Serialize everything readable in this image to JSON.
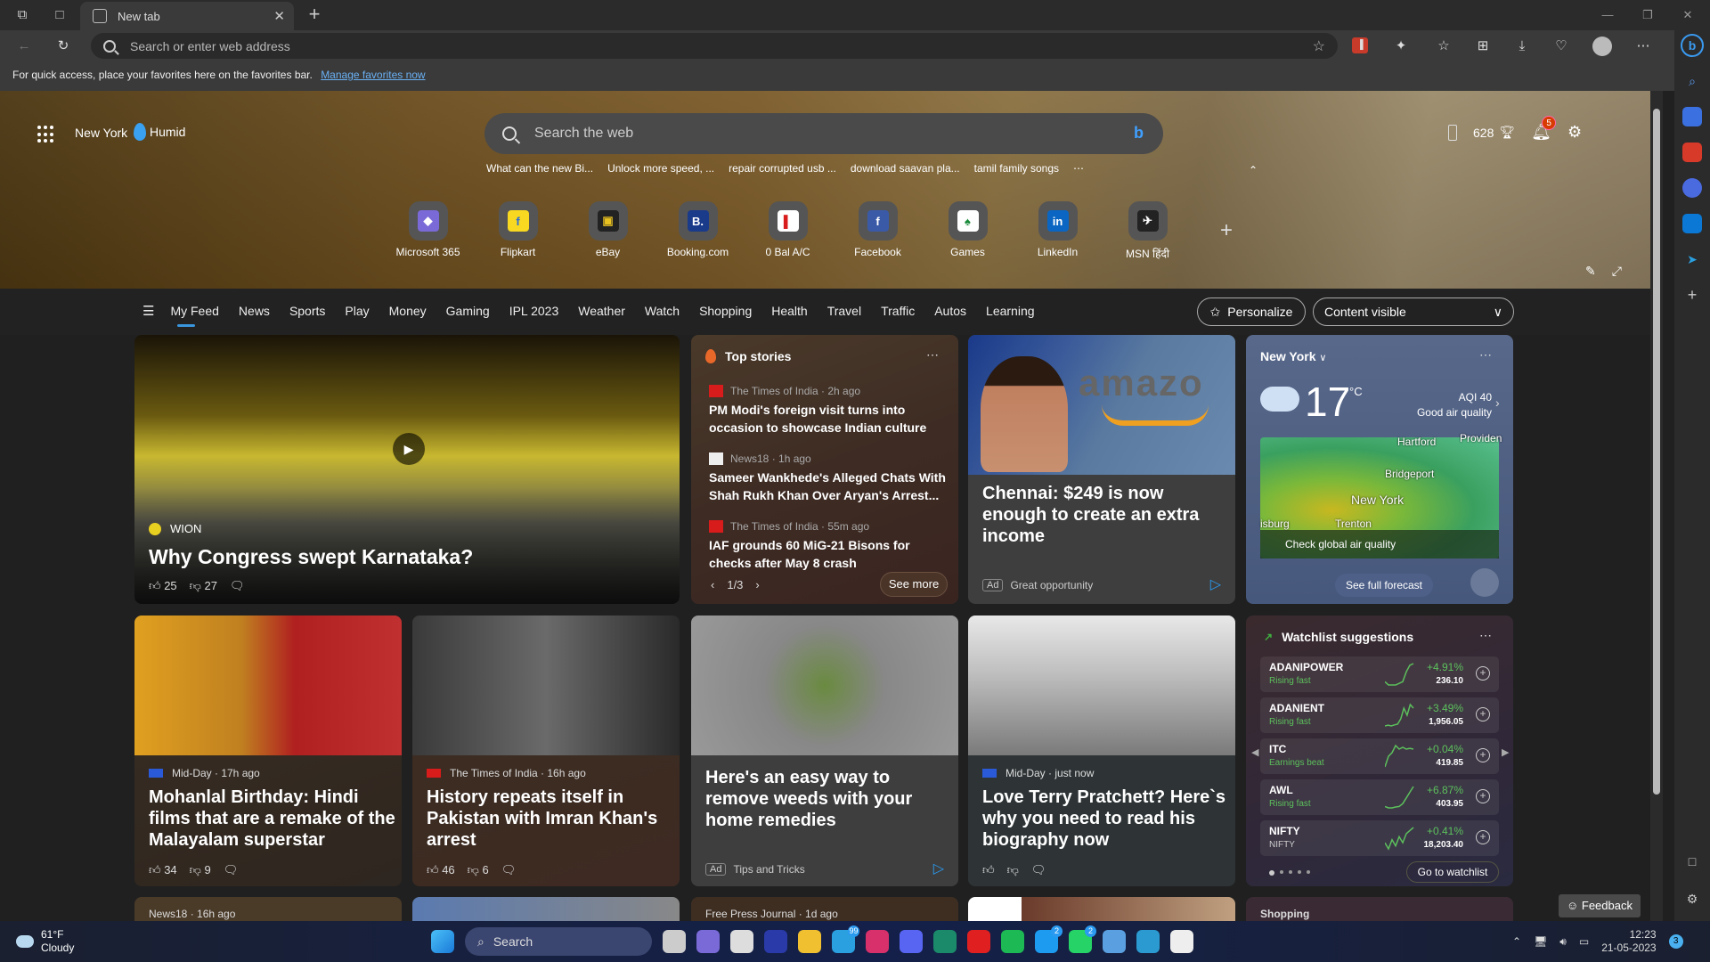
{
  "browser": {
    "tab_title": "New tab",
    "address_placeholder": "Search or enter web address",
    "favorites_bar_message": "For quick access, place your favorites here on the favorites bar.",
    "manage_favorites_link": "Manage favorites now",
    "toolbar_icons": [
      "add-favorite-icon",
      "extension-red-icon",
      "extensions-icon",
      "favorites-icon",
      "collections-icon",
      "downloads-icon",
      "browser-essentials-icon",
      "profile-icon",
      "more-icon",
      "bing-chat-icon"
    ]
  },
  "header": {
    "location": "New York",
    "weather_condition": "Humid",
    "search_placeholder": "Search the web",
    "trending": [
      "What can the new Bi...",
      "Unlock more speed, ...",
      "repair corrupted usb ...",
      "download saavan pla...",
      "tamil family songs"
    ],
    "trending_more": "⋯",
    "rewards_points": "628",
    "notification_count": "5"
  },
  "quick_links": [
    {
      "label": "Microsoft 365",
      "glyph": "◆",
      "bg": "#7a6ad8",
      "fg": "#fff"
    },
    {
      "label": "Flipkart",
      "glyph": "f",
      "bg": "#f8d820",
      "fg": "#2a6ad8"
    },
    {
      "label": "eBay",
      "glyph": "▣",
      "bg": "#222",
      "fg": "#e8c020"
    },
    {
      "label": "Booking.com",
      "glyph": "B.",
      "bg": "#1a3a8a",
      "fg": "#fff"
    },
    {
      "label": "0 Bal A/C",
      "glyph": "▌",
      "bg": "#fff",
      "fg": "#d81b1b"
    },
    {
      "label": "Facebook",
      "glyph": "f",
      "bg": "#3a5aa8",
      "fg": "#fff"
    },
    {
      "label": "Games",
      "glyph": "♠",
      "bg": "#fff",
      "fg": "#1a8a3a"
    },
    {
      "label": "LinkedIn",
      "glyph": "in",
      "bg": "#0a66c2",
      "fg": "#fff"
    },
    {
      "label": "MSN हिंदी",
      "glyph": "✈",
      "bg": "#222",
      "fg": "#fff"
    }
  ],
  "nav": {
    "items": [
      "My Feed",
      "News",
      "Sports",
      "Play",
      "Money",
      "Gaming",
      "IPL 2023",
      "Weather",
      "Watch",
      "Shopping",
      "Health",
      "Travel",
      "Traffic",
      "Autos",
      "Learning"
    ],
    "active": "My Feed",
    "personalize": "Personalize",
    "content_visibility": "Content visible"
  },
  "feature_video": {
    "source": "WION",
    "title": "Why Congress swept Karnataka?",
    "likes": "25",
    "dislikes": "27"
  },
  "top_stories": {
    "heading": "Top stories",
    "items": [
      {
        "source": "The Times of India · 2h ago",
        "title": "PM Modi's foreign visit turns into occasion to showcase Indian culture",
        "logo": "TOI"
      },
      {
        "source": "News18 · 1h ago",
        "title": "Sameer Wankhede's Alleged Chats With Shah Rukh Khan Over Aryan's Arrest...",
        "logo": "N18"
      },
      {
        "source": "The Times of India · 55m ago",
        "title": "IAF grounds 60 MiG-21 Bisons for checks after May 8 crash",
        "logo": "TOI"
      }
    ],
    "pager": "1/3",
    "see_more": "See more"
  },
  "ad_1": {
    "image_text": "amazo",
    "title": "Chennai: $249 is now enough to create an extra income",
    "ad_label": "Ad",
    "sponsor": "Great opportunity"
  },
  "weather": {
    "city": "New York",
    "temperature": "17",
    "unit": "°C",
    "aqi": "AQI 40",
    "aqi_label": "Good air quality",
    "map_labels": [
      "Hartford",
      "Providen",
      "Bridgeport",
      "New York",
      "Trenton",
      "isburg"
    ],
    "map_cta": "Check global air quality",
    "forecast_button": "See full forecast"
  },
  "news_cards": [
    {
      "source": "Mid-Day · 17h ago",
      "title": "Mohanlal Birthday: Hindi films that are a remake of the Malayalam superstar",
      "likes": "34",
      "dislikes": "9"
    },
    {
      "source": "The Times of India · 16h ago",
      "title": "History repeats itself in Pakistan with Imran Khan's arrest",
      "likes": "46",
      "dislikes": "6"
    },
    {
      "source": "Mid-Day · just now",
      "title": "Love Terry Pratchett? Here`s why you need to read his biography now",
      "likes": "",
      "dislikes": ""
    }
  ],
  "ad_2": {
    "title": "Here's an easy way to remove weeds with your home remedies",
    "ad_label": "Ad",
    "sponsor": "Tips and Tricks"
  },
  "watchlist": {
    "heading": "Watchlist suggestions",
    "stocks": [
      {
        "symbol": "ADANIPOWER",
        "note": "Rising fast",
        "change": "+4.91%",
        "price": "236.10",
        "spark": [
          3,
          2,
          2,
          2,
          2.5,
          3,
          6,
          8,
          8.5
        ]
      },
      {
        "symbol": "ADANIENT",
        "note": "Rising fast",
        "change": "+3.49%",
        "price": "1,956.05",
        "spark": [
          1,
          1.2,
          1,
          1.3,
          1.5,
          3,
          6,
          4,
          7,
          6
        ]
      },
      {
        "symbol": "ITC",
        "note": "Earnings beat",
        "change": "+0.04%",
        "price": "419.85",
        "spark": [
          2,
          5,
          6,
          8,
          7,
          7.5,
          7,
          7.2,
          7
        ]
      },
      {
        "symbol": "AWL",
        "note": "Rising fast",
        "change": "+6.87%",
        "price": "403.95",
        "spark": [
          2,
          1.5,
          1.5,
          1.8,
          2,
          3,
          5,
          7,
          9
        ]
      },
      {
        "symbol": "NIFTY",
        "note": "NIFTY",
        "change": "+0.41%",
        "price": "18,203.40",
        "spark": [
          4,
          2,
          5,
          3,
          6,
          4,
          7,
          8,
          9
        ]
      }
    ],
    "go_button": "Go to watchlist"
  },
  "peek_cards": [
    "News18 · 16h ago",
    "",
    "Free Press Journal · 1d ago",
    "",
    "Shopping"
  ],
  "feedback": "Feedback",
  "taskbar": {
    "weather_temp": "61°F",
    "weather_desc": "Cloudy",
    "search_label": "Search",
    "apps": [
      {
        "name": "task-view",
        "color": "#ccc",
        "badge": ""
      },
      {
        "name": "teams-chat",
        "color": "#7a6ad8",
        "badge": ""
      },
      {
        "name": "microsoft-store",
        "color": "#ddd",
        "badge": ""
      },
      {
        "name": "app-blue",
        "color": "#2a3aa8",
        "badge": ""
      },
      {
        "name": "file-explorer",
        "color": "#f0c030",
        "badge": ""
      },
      {
        "name": "telegram",
        "color": "#2aa0e0",
        "badge": "99"
      },
      {
        "name": "instagram",
        "color": "#d8306a",
        "badge": ""
      },
      {
        "name": "discord",
        "color": "#5865f2",
        "badge": ""
      },
      {
        "name": "edge-beta",
        "color": "#1a8a6a",
        "badge": ""
      },
      {
        "name": "youtube",
        "color": "#e02020",
        "badge": ""
      },
      {
        "name": "spotify",
        "color": "#1db954",
        "badge": ""
      },
      {
        "name": "twitter",
        "color": "#1d9bf0",
        "badge": "2"
      },
      {
        "name": "whatsapp",
        "color": "#25d366",
        "badge": "2"
      },
      {
        "name": "notepad",
        "color": "#5aa0e0",
        "badge": ""
      },
      {
        "name": "edge",
        "color": "#2a9ad0",
        "badge": ""
      },
      {
        "name": "snipping-tool",
        "color": "#eee",
        "badge": ""
      }
    ],
    "time": "12:23",
    "date": "21-05-2023",
    "notification_count": "3"
  }
}
